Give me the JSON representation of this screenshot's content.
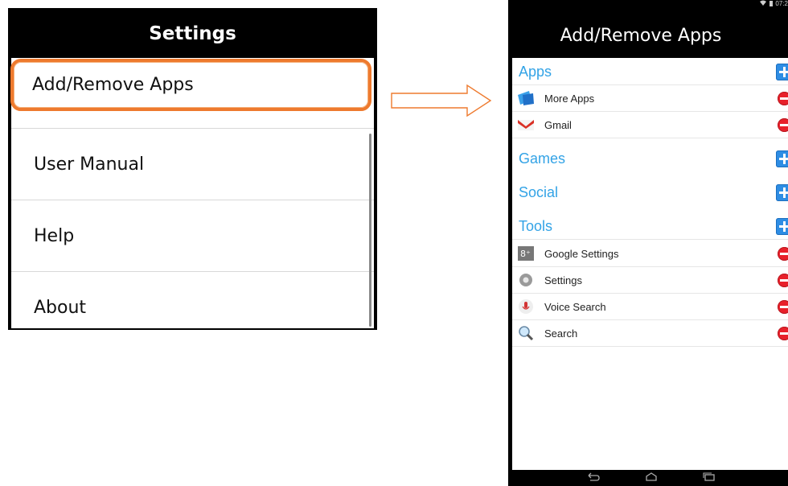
{
  "settings": {
    "title": "Settings",
    "items": [
      {
        "label": "Add/Remove Apps"
      },
      {
        "label": "User Manual"
      },
      {
        "label": "Help"
      },
      {
        "label": "About"
      }
    ]
  },
  "phone": {
    "status_time": "07:2",
    "title": "Add/Remove Apps",
    "categories": [
      {
        "label": "Apps",
        "apps": [
          {
            "label": "More Apps",
            "icon": "more-apps-icon"
          },
          {
            "label": "Gmail",
            "icon": "gmail-icon"
          }
        ]
      },
      {
        "label": "Games",
        "apps": []
      },
      {
        "label": "Social",
        "apps": []
      },
      {
        "label": "Tools",
        "apps": [
          {
            "label": "Google Settings",
            "icon": "google-settings-icon"
          },
          {
            "label": "Settings",
            "icon": "settings-gear-icon"
          },
          {
            "label": "Voice Search",
            "icon": "microphone-icon"
          },
          {
            "label": "Search",
            "icon": "magnifier-icon"
          }
        ]
      }
    ]
  },
  "colors": {
    "highlight": "#ee7a2e",
    "category_text": "#33a3e6",
    "add_button": "#2e8de4",
    "remove_button": "#e8202a"
  }
}
